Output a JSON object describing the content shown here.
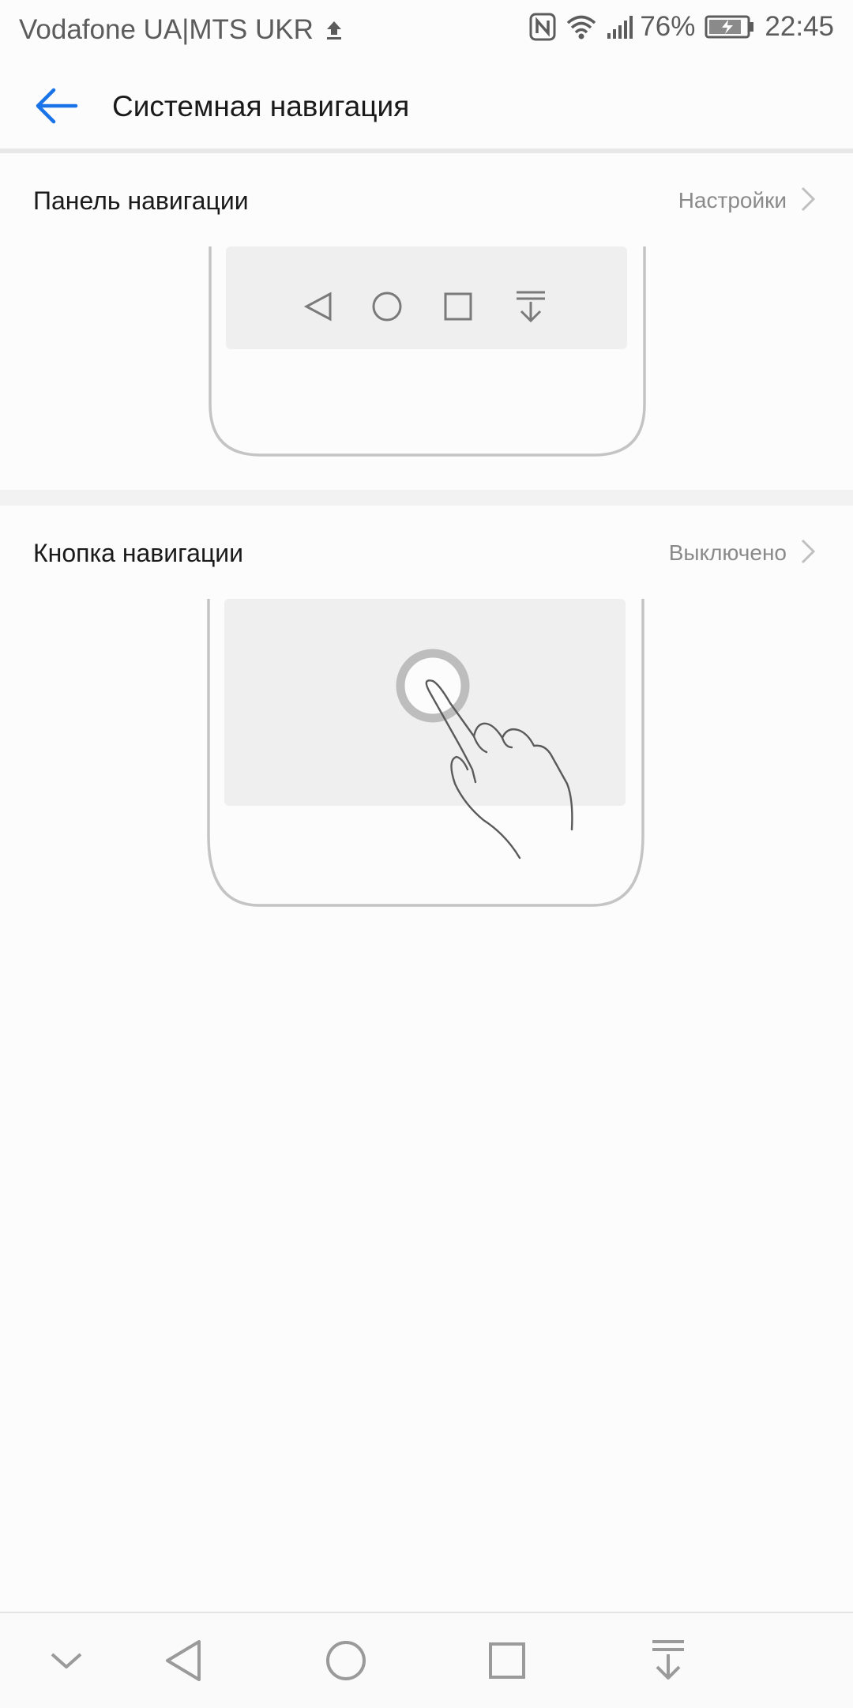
{
  "status_bar": {
    "carrier": "Vodafone UA|MTS UKR",
    "battery_percent": "76%",
    "time": "22:45",
    "icons": [
      "upload-icon",
      "nfc-icon",
      "wifi-icon",
      "signal-icon",
      "battery-charging-icon"
    ]
  },
  "app_bar": {
    "back_icon": "arrow-left-icon",
    "title": "Системная навигация",
    "accent_color": "#1a73e8"
  },
  "sections": [
    {
      "label": "Панель навигации",
      "value": "Настройки",
      "illustration": "phone-navigation-bar-illustration"
    },
    {
      "label": "Кнопка навигации",
      "value": "Выключено",
      "illustration": "phone-floating-button-illustration"
    }
  ],
  "system_nav": {
    "buttons": [
      "chevron-down-icon",
      "back-triangle-icon",
      "home-circle-icon",
      "recents-square-icon",
      "notifications-pull-icon"
    ]
  }
}
